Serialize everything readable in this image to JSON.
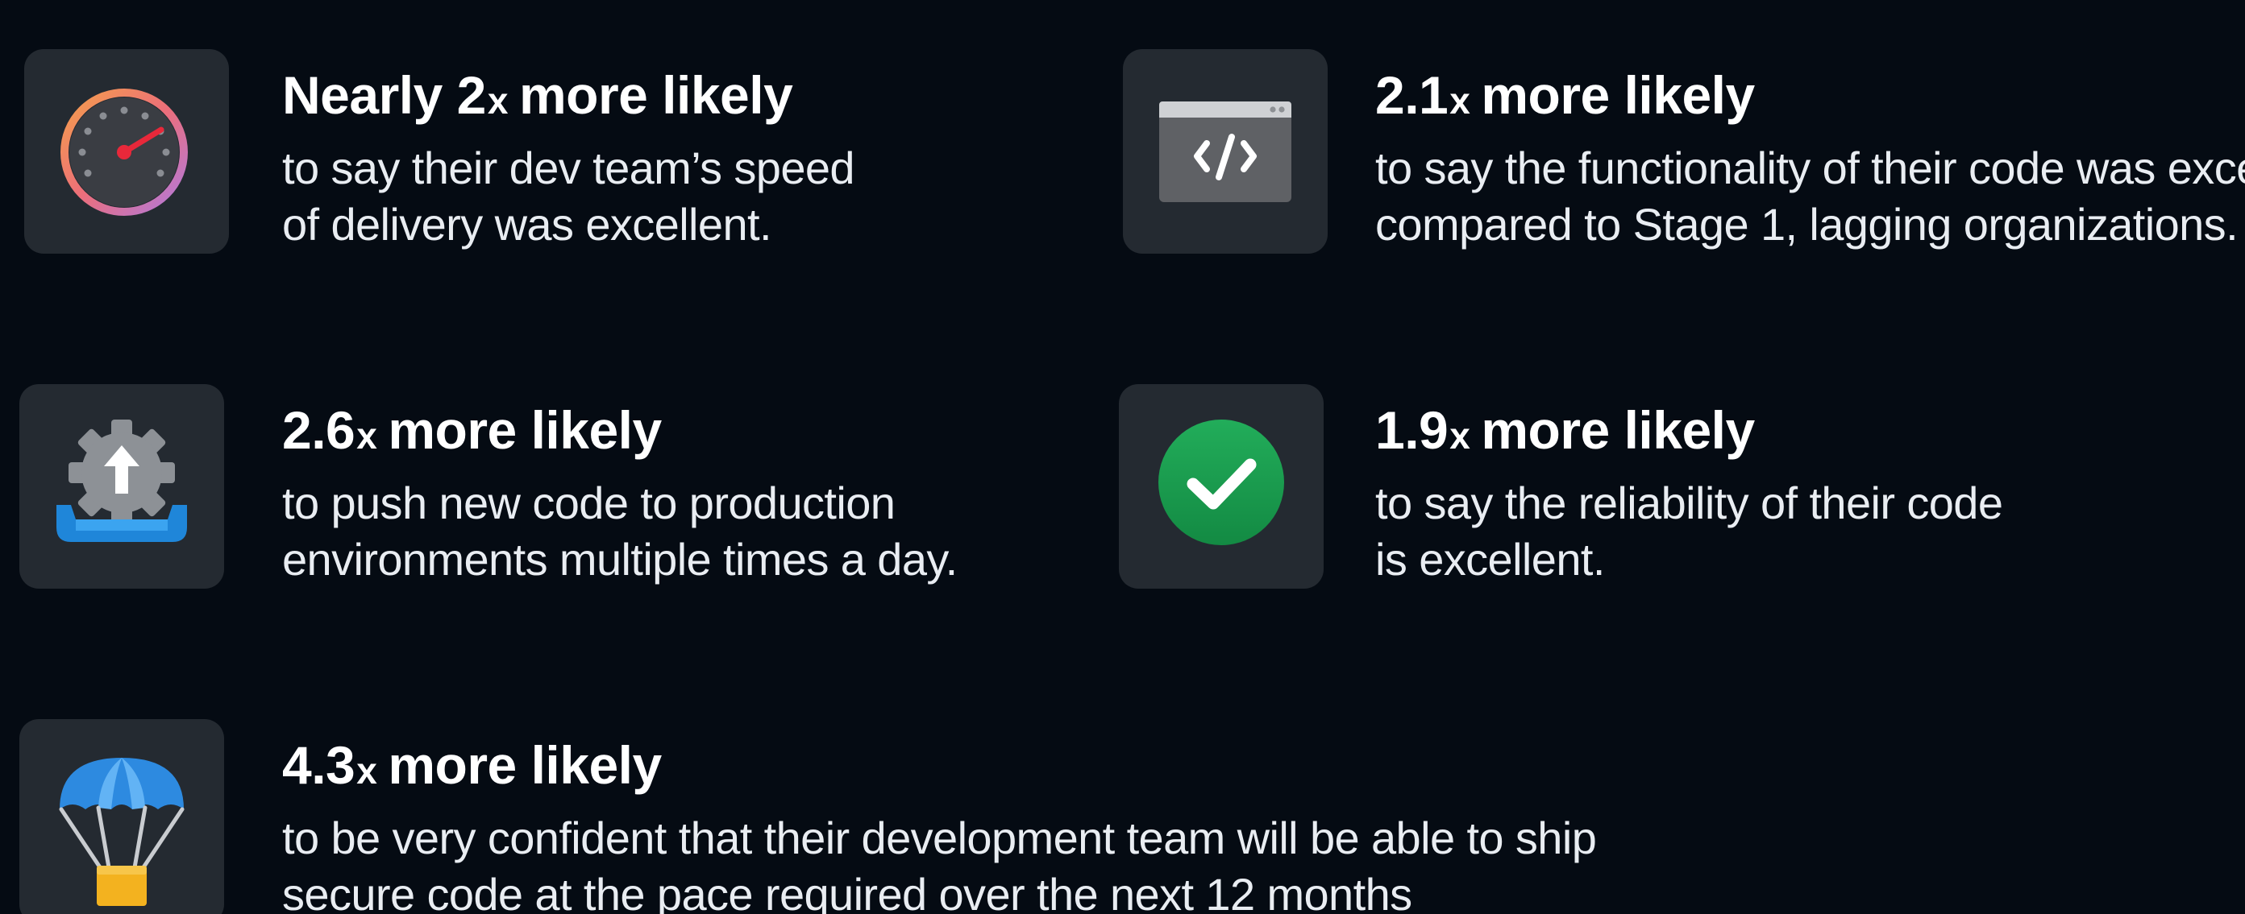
{
  "stats": [
    {
      "icon": "speedometer-icon",
      "prefix": "Nearly ",
      "multiplier": "2",
      "multiplier_unit": "x",
      "suffix": "more likely",
      "lines": [
        "to say their dev team’s speed",
        "of delivery was excellent."
      ]
    },
    {
      "icon": "code-window-icon",
      "prefix": "",
      "multiplier": "2.1",
      "multiplier_unit": "x",
      "suffix": "more likely",
      "lines": [
        "to say the functionality of their code was excellent,",
        "compared to Stage 1, lagging organizations."
      ]
    },
    {
      "icon": "deploy-gear-upload-icon",
      "prefix": "",
      "multiplier": "2.6",
      "multiplier_unit": "x",
      "suffix": "more likely",
      "lines": [
        "to push new code to production",
        "environments multiple times a day."
      ]
    },
    {
      "icon": "check-circle-icon",
      "prefix": "",
      "multiplier": "1.9",
      "multiplier_unit": "x",
      "suffix": "more likely",
      "lines": [
        "to say the reliability of their code",
        "is excellent."
      ]
    },
    {
      "icon": "parachute-package-icon",
      "prefix": "",
      "multiplier": "4.3",
      "multiplier_unit": "x",
      "suffix": "more likely",
      "lines": [
        "to be very confident that their development team will be able to ship",
        "secure code at the pace required over the next 12 months"
      ]
    }
  ],
  "colors": {
    "background": "#050b13",
    "icon_tile": "#242a31",
    "text": "#ffffff",
    "check_green": "#1c9b4e",
    "deploy_blue": "#1f86d9",
    "parachute_blue": "#2d8ae0",
    "package_gold": "#f3b21f"
  }
}
